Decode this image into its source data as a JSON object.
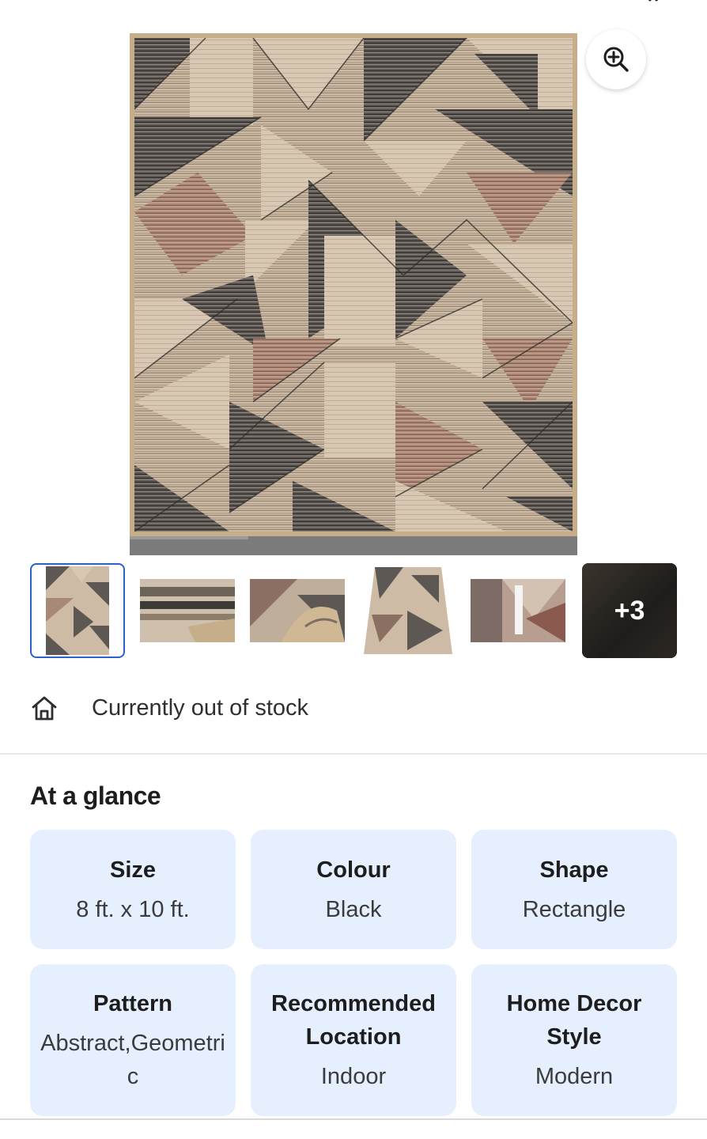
{
  "colors": {
    "accent": "#2a62c9",
    "card_bg": "#e6effd",
    "text_primary": "#1d1d1d",
    "text_secondary": "#3a3b3d"
  },
  "gallery": {
    "zoom_icon": "zoom-in-icon",
    "thumbnails": [
      {
        "name": "thumbnail-1",
        "selected": true
      },
      {
        "name": "thumbnail-2",
        "selected": false
      },
      {
        "name": "thumbnail-3",
        "selected": false
      },
      {
        "name": "thumbnail-4",
        "selected": false
      },
      {
        "name": "thumbnail-5",
        "selected": false
      }
    ],
    "more_label": "+3"
  },
  "availability": {
    "icon": "home-icon",
    "text": "Currently out of stock"
  },
  "at_a_glance": {
    "title": "At a glance",
    "specs": [
      {
        "title": "Size",
        "value": "8 ft. x 10 ft."
      },
      {
        "title": "Colour",
        "value": "Black"
      },
      {
        "title": "Shape",
        "value": "Rectangle"
      },
      {
        "title": "Pattern",
        "value": "Abstract,Geometric"
      },
      {
        "title": "Recommended Location",
        "value": "Indoor"
      },
      {
        "title": "Home Decor Style",
        "value": "Modern"
      }
    ]
  }
}
